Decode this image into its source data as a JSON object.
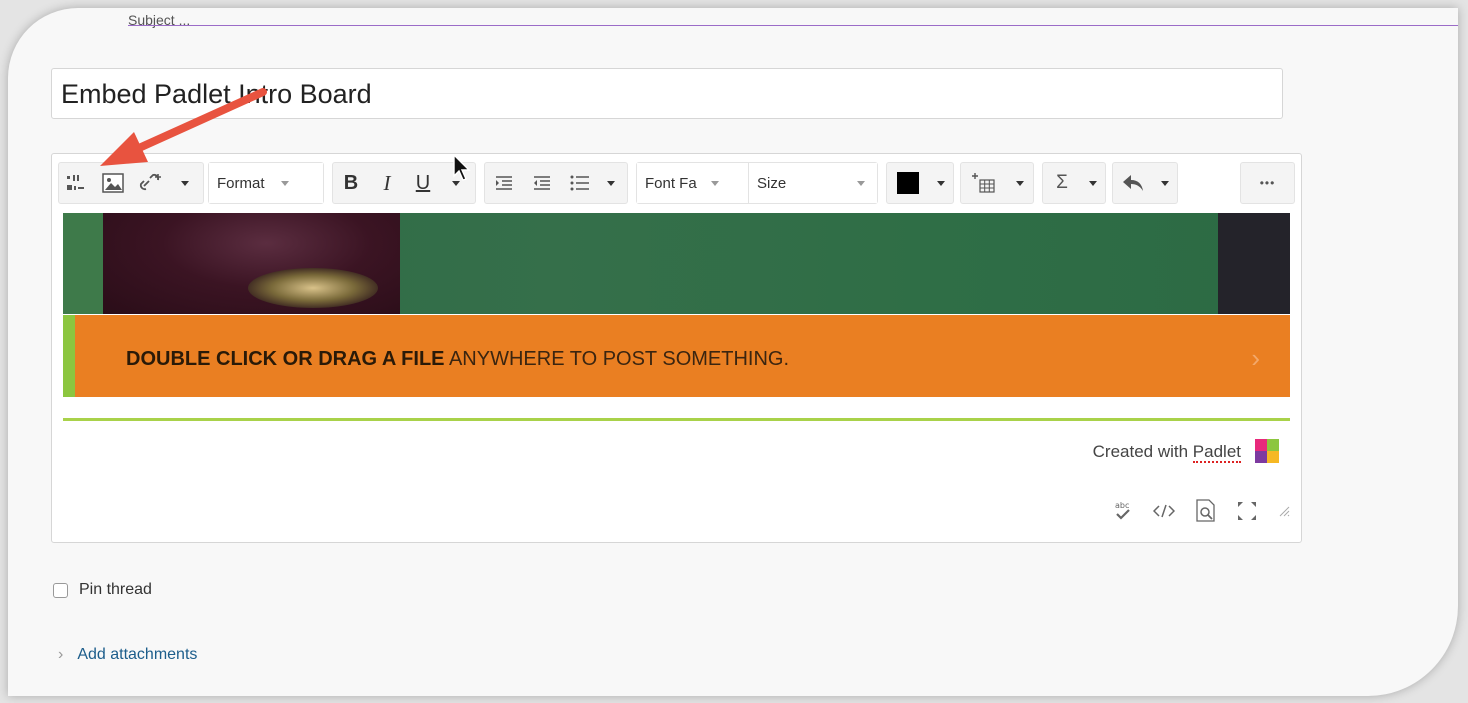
{
  "page": {
    "cut_text": "Subject ..."
  },
  "title_field": {
    "value": "Embed Padlet Intro Board"
  },
  "toolbar": {
    "format_label": "Format",
    "bold": "B",
    "italic": "I",
    "underline": "U",
    "font_family_label": "Font Fa",
    "size_label": "Size",
    "sigma": "Σ",
    "more": "•••"
  },
  "embed": {
    "banner_bold": "DOUBLE CLICK OR DRAG A FILE",
    "banner_rest": " ANYWHERE TO POST SOMETHING.",
    "created_prefix": "Created with ",
    "created_link": "Padlet"
  },
  "options": {
    "pin_label": "Pin thread",
    "attach_label": "Add attachments"
  },
  "colors": {
    "accent_arrow": "#e8533f",
    "banner_orange": "#ea7f22",
    "board_green": "#2f6e46",
    "link_blue": "#1c5d8b",
    "lime": "#a9d24a"
  }
}
